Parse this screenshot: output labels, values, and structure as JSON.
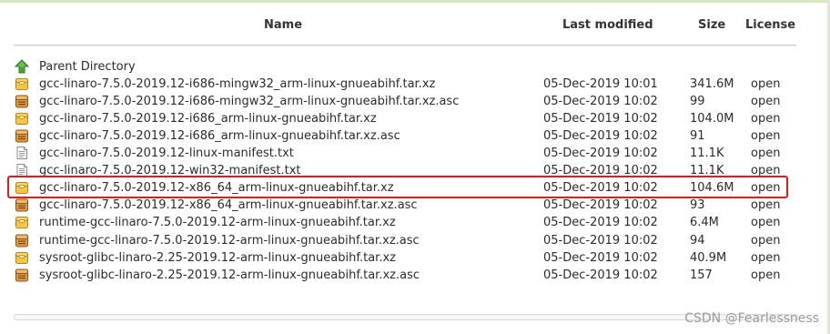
{
  "table": {
    "headers": {
      "name": "Name",
      "last_modified": "Last modified",
      "size": "Size",
      "license": "License"
    },
    "parent": {
      "label": "Parent Directory",
      "icon": "up-arrow-icon"
    },
    "rows": [
      {
        "name": "gcc-linaro-7.5.0-2019.12-i686-mingw32_arm-linux-gnueabihf.tar.xz",
        "modified": "05-Dec-2019 10:01",
        "size": "341.6M",
        "license": "open",
        "icon": "archive-icon"
      },
      {
        "name": "gcc-linaro-7.5.0-2019.12-i686-mingw32_arm-linux-gnueabihf.tar.xz.asc",
        "modified": "05-Dec-2019 10:02",
        "size": "99",
        "license": "open",
        "icon": "signature-file-icon"
      },
      {
        "name": "gcc-linaro-7.5.0-2019.12-i686_arm-linux-gnueabihf.tar.xz",
        "modified": "05-Dec-2019 10:02",
        "size": "104.0M",
        "license": "open",
        "icon": "archive-icon"
      },
      {
        "name": "gcc-linaro-7.5.0-2019.12-i686_arm-linux-gnueabihf.tar.xz.asc",
        "modified": "05-Dec-2019 10:02",
        "size": "91",
        "license": "open",
        "icon": "signature-file-icon"
      },
      {
        "name": "gcc-linaro-7.5.0-2019.12-linux-manifest.txt",
        "modified": "05-Dec-2019 10:02",
        "size": "11.1K",
        "license": "open",
        "icon": "text-file-icon"
      },
      {
        "name": "gcc-linaro-7.5.0-2019.12-win32-manifest.txt",
        "modified": "05-Dec-2019 10:02",
        "size": "11.1K",
        "license": "open",
        "icon": "text-file-icon"
      },
      {
        "name": "gcc-linaro-7.5.0-2019.12-x86_64_arm-linux-gnueabihf.tar.xz",
        "modified": "05-Dec-2019 10:02",
        "size": "104.6M",
        "license": "open",
        "icon": "archive-icon"
      },
      {
        "name": "gcc-linaro-7.5.0-2019.12-x86_64_arm-linux-gnueabihf.tar.xz.asc",
        "modified": "05-Dec-2019 10:02",
        "size": "93",
        "license": "open",
        "icon": "signature-file-icon"
      },
      {
        "name": "runtime-gcc-linaro-7.5.0-2019.12-arm-linux-gnueabihf.tar.xz",
        "modified": "05-Dec-2019 10:02",
        "size": "6.4M",
        "license": "open",
        "icon": "archive-icon"
      },
      {
        "name": "runtime-gcc-linaro-7.5.0-2019.12-arm-linux-gnueabihf.tar.xz.asc",
        "modified": "05-Dec-2019 10:02",
        "size": "94",
        "license": "open",
        "icon": "signature-file-icon"
      },
      {
        "name": "sysroot-glibc-linaro-2.25-2019.12-arm-linux-gnueabihf.tar.xz",
        "modified": "05-Dec-2019 10:02",
        "size": "40.9M",
        "license": "open",
        "icon": "archive-icon"
      },
      {
        "name": "sysroot-glibc-linaro-2.25-2019.12-arm-linux-gnueabihf.tar.xz.asc",
        "modified": "05-Dec-2019 10:02",
        "size": "157",
        "license": "open",
        "icon": "signature-file-icon"
      }
    ],
    "highlighted_row_index": 6,
    "highlight_color": "#e11b1b"
  },
  "watermark": "CSDN @Fearlessness"
}
